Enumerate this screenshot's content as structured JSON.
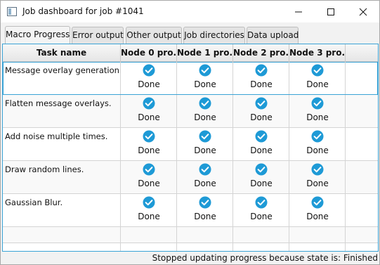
{
  "window": {
    "title": "Job dashboard for job #1041",
    "icon": "app-window-icon"
  },
  "tabs": [
    {
      "label": "Macro Progress",
      "active": true
    },
    {
      "label": "Error output",
      "active": false
    },
    {
      "label": "Other output",
      "active": false
    },
    {
      "label": "Job directories",
      "active": false
    },
    {
      "label": "Data upload",
      "active": false
    }
  ],
  "table": {
    "columns": [
      "Task name",
      "Node 0 pro...",
      "Node 1 pro...",
      "Node 2 pro...",
      "Node 3 pro..."
    ],
    "rows": [
      {
        "task": "Message overlay generation.",
        "nodes": [
          "Done",
          "Done",
          "Done",
          "Done"
        ],
        "selected": true
      },
      {
        "task": "Flatten message overlays.",
        "nodes": [
          "Done",
          "Done",
          "Done",
          "Done"
        ],
        "selected": false
      },
      {
        "task": "Add noise multiple times.",
        "nodes": [
          "Done",
          "Done",
          "Done",
          "Done"
        ],
        "selected": false
      },
      {
        "task": "Draw random lines.",
        "nodes": [
          "Done",
          "Done",
          "Done",
          "Done"
        ],
        "selected": false
      },
      {
        "task": "Gaussian Blur.",
        "nodes": [
          "Done",
          "Done",
          "Done",
          "Done"
        ],
        "selected": false
      }
    ],
    "status_icon": "check-circle-icon"
  },
  "statusbar": {
    "text": "Stopped updating progress because state is: Finished"
  },
  "colors": {
    "accent": "#3aa3d6",
    "check": "#1e9ad6"
  }
}
